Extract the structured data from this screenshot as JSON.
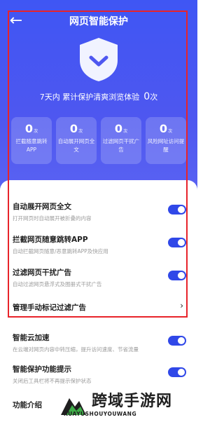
{
  "header": {
    "title": "网页智能保护"
  },
  "summary": {
    "text": "7天内 累计保护清爽浏览体验",
    "count": "0",
    "unit": "次"
  },
  "stats": [
    {
      "value": "0",
      "unit": "次",
      "label": "拦截随意跳转APP"
    },
    {
      "value": "0",
      "unit": "次",
      "label": "自动展开网页全文"
    },
    {
      "value": "0",
      "unit": "次",
      "label": "过滤网页干扰广告"
    },
    {
      "value": "0",
      "unit": "次",
      "label": "风险网址访问提醒"
    }
  ],
  "settings": [
    {
      "title": "自动展开网页全文",
      "subtitle": "打开网页时自动展开被折叠的内容",
      "enabled": true
    },
    {
      "title": "拦截网页随意跳转APP",
      "subtitle": "自动拦截网页随意/恶意跳转APP及快应用",
      "enabled": true
    },
    {
      "title": "过滤网页干扰广告",
      "subtitle": "自动过滤网页悬浮式及图册式干扰广告",
      "enabled": true
    },
    {
      "title": "管理手动标记过滤广告",
      "subtitle": ""
    },
    {
      "title": "智能云加速",
      "subtitle": "在云端对网页内容中转压缩，提升访问速度、节省流量",
      "enabled": true
    },
    {
      "title": "智能保护功能提示",
      "subtitle": "关闭后工具栏将不再提示保护状态",
      "enabled": true
    },
    {
      "title": "功能介绍",
      "subtitle": ""
    }
  ],
  "watermark": {
    "text": "跨域手游网",
    "sub": "KUAYUSHOUYOUWANG"
  },
  "colors": {
    "accent": "#3048e8",
    "hero": "#4e57f0",
    "frame": "#e8232a"
  }
}
